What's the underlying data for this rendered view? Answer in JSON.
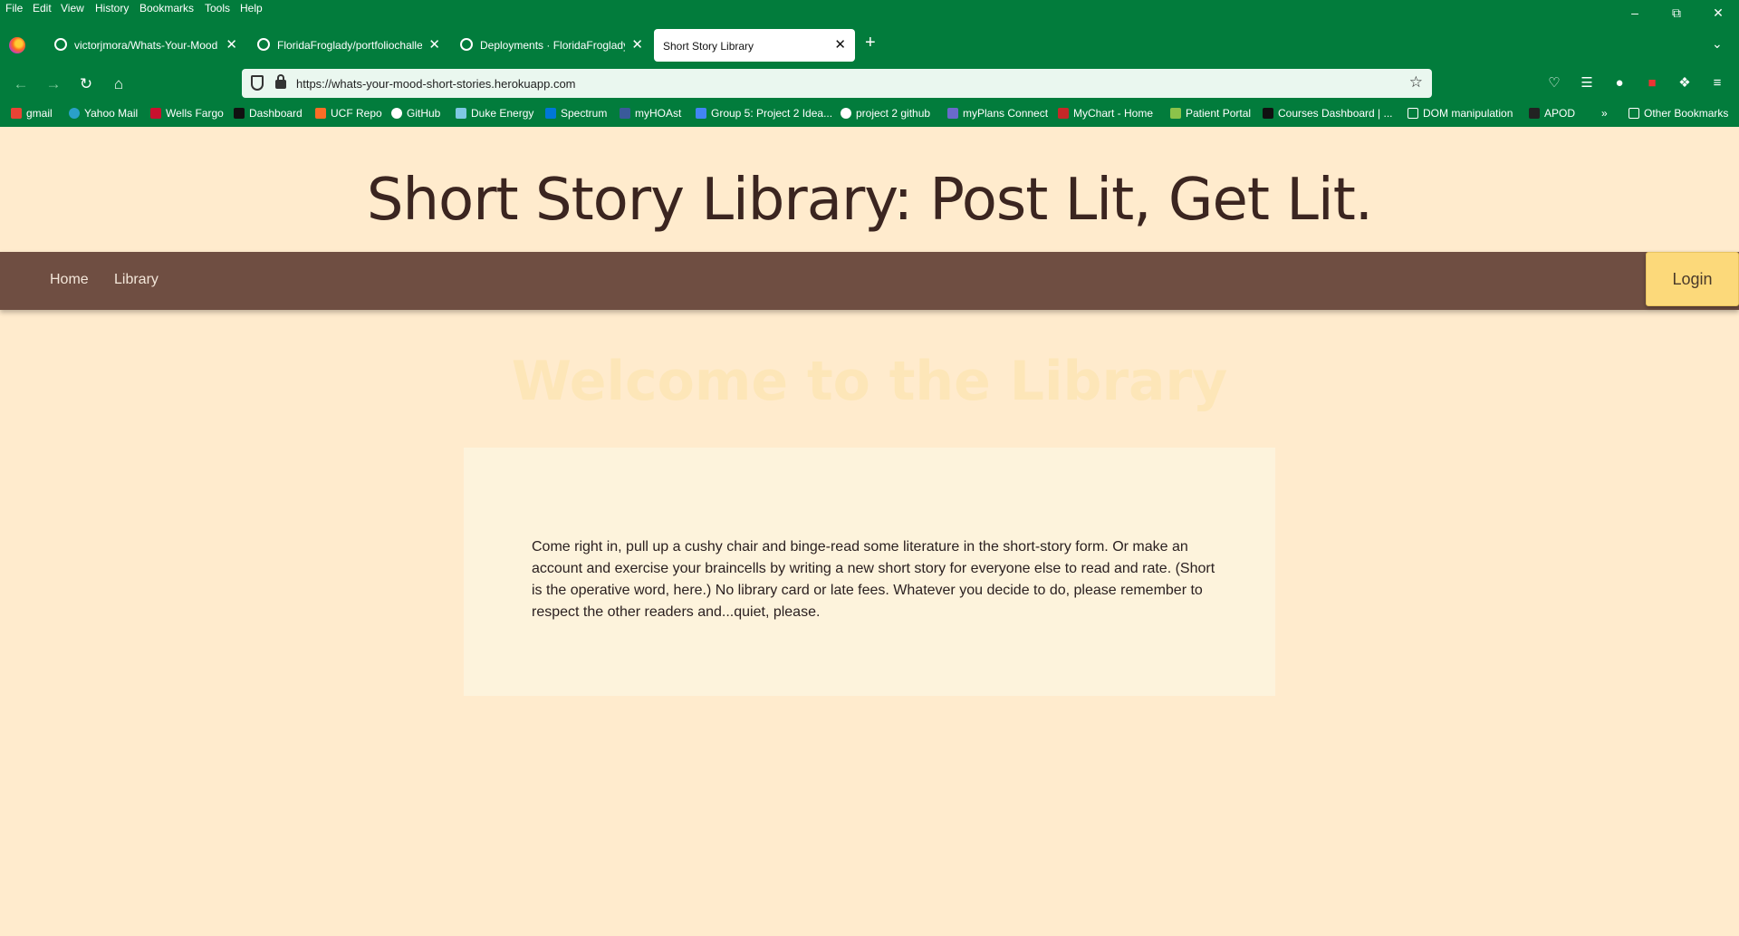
{
  "menu": [
    "File",
    "Edit",
    "View",
    "History",
    "Bookmarks",
    "Tools",
    "Help"
  ],
  "tabs": [
    {
      "title": "victorjmora/Whats-Your-Mood"
    },
    {
      "title": "FloridaFroglady/portfoliochallenge"
    },
    {
      "title": "Deployments · FloridaFroglady/"
    },
    {
      "title": "Short Story Library"
    }
  ],
  "url": "https://whats-your-mood-short-stories.herokuapp.com",
  "bookmarks": [
    "gmail",
    "Yahoo Mail",
    "Wells Fargo",
    "Dashboard",
    "UCF Repo",
    "GitHub",
    "Duke Energy",
    "Spectrum",
    "myHOAst",
    "Group 5: Project 2 Idea...",
    "project 2 github",
    "myPlans Connect",
    "MyChart - Home",
    "Patient Portal",
    "Courses Dashboard | ...",
    "DOM manipulation",
    "APOD"
  ],
  "other_bookmarks": "Other Bookmarks",
  "page": {
    "title": "Short Story Library: Post Lit, Get Lit.",
    "nav": {
      "home": "Home",
      "library": "Library",
      "login": "Login"
    },
    "welcome": "Welcome to the Library",
    "intro": "Come right in, pull up a cushy chair and binge-read some literature in the short-story form. Or make an account and exercise your braincells by writing a new short story for everyone else to read and rate. (Short is the operative word, here.) No library card or late fees. Whatever you decide to do, please remember to respect the other readers and...quiet, please."
  },
  "colors": {
    "chrome": "#027c3c",
    "page_bg": "#ffebcd",
    "nav_bg": "#6f4e42",
    "login_bg": "#fcd97a",
    "card_bg": "#fdf3dc"
  }
}
